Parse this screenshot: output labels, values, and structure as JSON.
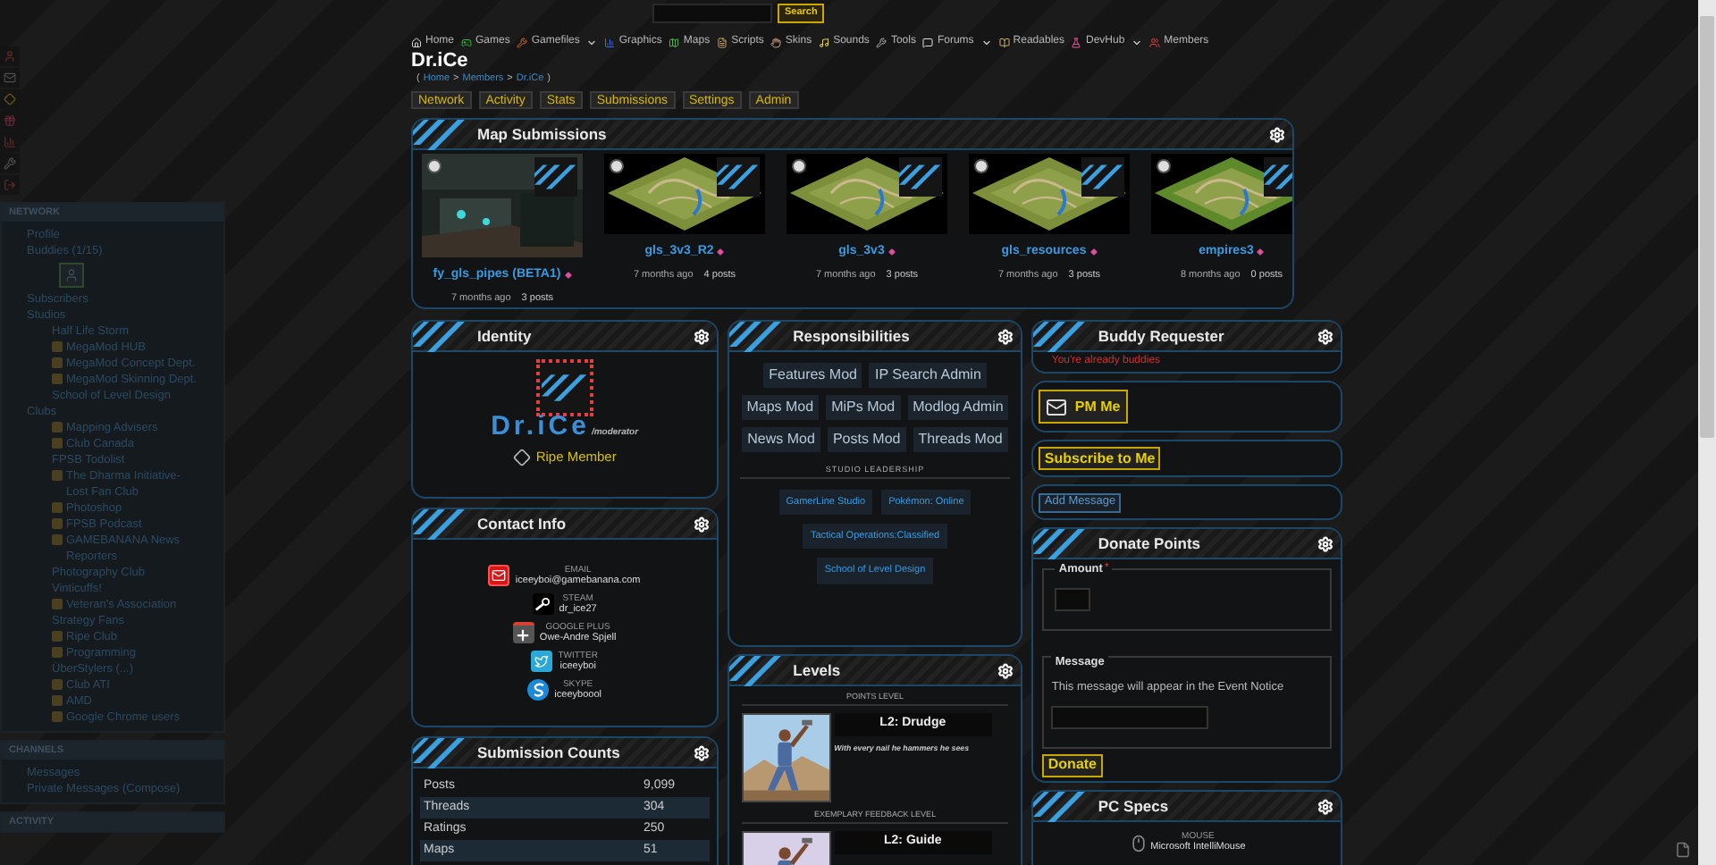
{
  "search": {
    "button": "Search"
  },
  "nav": [
    {
      "label": "Home",
      "dropdown": false
    },
    {
      "label": "Games",
      "dropdown": false
    },
    {
      "label": "Gamefiles",
      "dropdown": true
    },
    {
      "label": "Graphics",
      "dropdown": false
    },
    {
      "label": "Maps",
      "dropdown": false
    },
    {
      "label": "Scripts",
      "dropdown": false
    },
    {
      "label": "Skins",
      "dropdown": false
    },
    {
      "label": "Sounds",
      "dropdown": false
    },
    {
      "label": "Tools",
      "dropdown": false
    },
    {
      "label": "Forums",
      "dropdown": true
    },
    {
      "label": "Readables",
      "dropdown": false
    },
    {
      "label": "DevHub",
      "dropdown": true
    },
    {
      "label": "Members",
      "dropdown": false
    }
  ],
  "profile": {
    "title": "Dr.iCe",
    "breadcrumb": [
      {
        "kind": "punct",
        "text": "("
      },
      {
        "kind": "link",
        "text": "Home"
      },
      {
        "kind": "punct",
        "text": ">"
      },
      {
        "kind": "link",
        "text": "Members"
      },
      {
        "kind": "punct",
        "text": ">"
      },
      {
        "kind": "link",
        "text": "Dr.iCe"
      },
      {
        "kind": "punct",
        "text": ")"
      }
    ]
  },
  "tabs": [
    "Network",
    "Activity",
    "Stats",
    "Submissions",
    "Settings",
    "Admin"
  ],
  "sidebar": [
    {
      "title": "NETWORK",
      "items": [
        {
          "label": "Profile",
          "kind": "link"
        },
        {
          "label": "Buddies (1/15)",
          "kind": "buddies"
        },
        {
          "label": "Subscribers",
          "kind": "link"
        },
        {
          "label": "Studios",
          "kind": "group",
          "children": [
            {
              "label": "Half Life Storm",
              "icon": false
            },
            {
              "label": "MegaMod HUB",
              "icon": true
            },
            {
              "label": "MegaMod Concept Dept.",
              "icon": true
            },
            {
              "label": "MegaMod Skinning Dept.",
              "icon": true
            },
            {
              "label": "School of Level Design",
              "icon": false
            }
          ]
        },
        {
          "label": "Clubs",
          "kind": "group",
          "children": [
            {
              "label": "Mapping Advisers",
              "icon": true
            },
            {
              "label": "Club Canada",
              "icon": true
            },
            {
              "label": "FPSB Todolist",
              "icon": false
            },
            {
              "label": "The Dharma Initiative-Lost Fan Club",
              "icon": true
            },
            {
              "label": "Photoshop",
              "icon": true
            },
            {
              "label": "FPSB Podcast",
              "icon": true
            },
            {
              "label": "GAMEBANANA News Reporters",
              "icon": true
            },
            {
              "label": "Photography Club",
              "icon": false
            },
            {
              "label": "Vinticuffs!",
              "icon": false
            },
            {
              "label": "Veteran's Association",
              "icon": true
            },
            {
              "label": "Strategy Fans",
              "icon": false
            },
            {
              "label": "Ripe Club",
              "icon": true
            },
            {
              "label": "Programming",
              "icon": true
            },
            {
              "label": "ÜberStylers (...)",
              "icon": false
            },
            {
              "label": "Club ATI",
              "icon": true
            },
            {
              "label": "AMD",
              "icon": true
            },
            {
              "label": "Google Chrome users",
              "icon": true
            }
          ]
        }
      ]
    },
    {
      "title": "CHANNELS",
      "items": [
        {
          "label": "Messages",
          "kind": "link"
        },
        {
          "label": "Private Messages (Compose)",
          "kind": "link"
        }
      ]
    },
    {
      "title": "ACTIVITY"
    }
  ],
  "map_submissions": {
    "title": "Map Submissions",
    "items": [
      {
        "name": "fy_gls_pipes (BETA1)",
        "age": "7 months ago",
        "posts": "3 posts"
      },
      {
        "name": "gls_3v3_R2",
        "age": "7 months ago",
        "posts": "4 posts"
      },
      {
        "name": "gls_3v3",
        "age": "7 months ago",
        "posts": "3 posts"
      },
      {
        "name": "gls_resources",
        "age": "7 months ago",
        "posts": "3 posts"
      },
      {
        "name": "empires3",
        "age": "8 months ago",
        "posts": "0 posts"
      }
    ]
  },
  "identity": {
    "title": "Identity",
    "logo_name": "Dr.iCe",
    "logo_role": "/moderator",
    "membership": "Ripe Member"
  },
  "contact": {
    "title": "Contact Info",
    "items": [
      {
        "kind": "email",
        "label": "EMAIL",
        "value": "iceeyboi@gamebanana.com"
      },
      {
        "kind": "steam",
        "label": "STEAM",
        "value": "dr_ice27"
      },
      {
        "kind": "googleplus",
        "label": "GOOGLE PLUS",
        "value": "Owe-Andre Spjell"
      },
      {
        "kind": "twitter",
        "label": "TWITTER",
        "value": "iceeyboi"
      },
      {
        "kind": "skype",
        "label": "SKYPE",
        "value": "iceeyboool"
      }
    ]
  },
  "submission_counts": {
    "title": "Submission Counts",
    "rows": [
      {
        "label": "Posts",
        "value": "9,099"
      },
      {
        "label": "Threads",
        "value": "304"
      },
      {
        "label": "Ratings",
        "value": "250"
      },
      {
        "label": "Maps",
        "value": "51"
      }
    ]
  },
  "responsibilities": {
    "title": "Responsibilities",
    "roles": [
      "Features Mod",
      "IP Search Admin",
      "Maps Mod",
      "MiPs Mod",
      "Modlog Admin",
      "News Mod",
      "Posts Mod",
      "Threads Mod"
    ],
    "studio_heading": "STUDIO LEADERSHIP",
    "studios": [
      "GamerLine Studio",
      "Pokémon: Online",
      "Tactical Operations:Classified",
      "School of Level Design"
    ]
  },
  "levels": {
    "title": "Levels",
    "items": [
      {
        "heading": "POINTS LEVEL",
        "name": "L2: Drudge",
        "description": "With every nail he hammers he sees"
      },
      {
        "heading": "EXEMPLARY FEEDBACK LEVEL",
        "name": "L2: Guide"
      }
    ]
  },
  "buddy_requester": {
    "title": "Buddy Requester",
    "message": "You're already buddies"
  },
  "pm_button": "PM Me",
  "subscribe_button": "Subscribe to Me",
  "add_message_button": "Add Message",
  "donate": {
    "title": "Donate Points",
    "amount_label": "Amount",
    "required_mark": "*",
    "message_label": "Message",
    "message_hint": "This message will appear in the Event Notice",
    "button": "Donate"
  },
  "pc_specs": {
    "title": "PC Specs",
    "items": [
      {
        "label": "MOUSE",
        "value": "Microsoft IntelliMouse"
      }
    ]
  }
}
